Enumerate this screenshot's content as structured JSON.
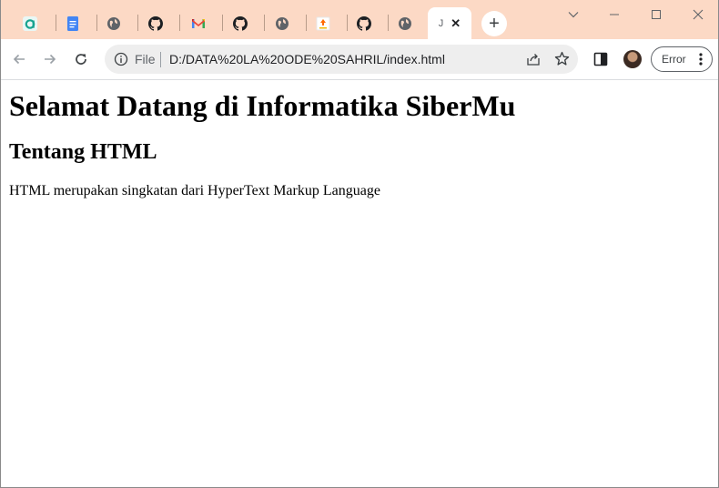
{
  "browser": {
    "tabs": [
      {
        "icon": "app-a-icon"
      },
      {
        "icon": "google-docs-icon"
      },
      {
        "icon": "globe-icon"
      },
      {
        "icon": "github-icon"
      },
      {
        "icon": "gmail-icon"
      },
      {
        "icon": "github-icon"
      },
      {
        "icon": "globe-icon"
      },
      {
        "icon": "upload-page-icon"
      },
      {
        "icon": "github-icon"
      },
      {
        "icon": "globe-icon"
      },
      {
        "icon": "document-icon",
        "initial": "J",
        "active": true
      }
    ],
    "close_symbol": "✕",
    "new_tab_symbol": "+",
    "tabstrip_color": "#fcd9c5"
  },
  "toolbar": {
    "scheme_label": "File",
    "url": "D:/DATA%20LA%20ODE%20SAHRIL/index.html",
    "error_label": "Error"
  },
  "page": {
    "heading1": "Selamat Datang di Informatika SiberMu",
    "heading2": "Tentang HTML",
    "paragraph": "HTML merupakan singkatan dari HyperText Markup Language"
  }
}
